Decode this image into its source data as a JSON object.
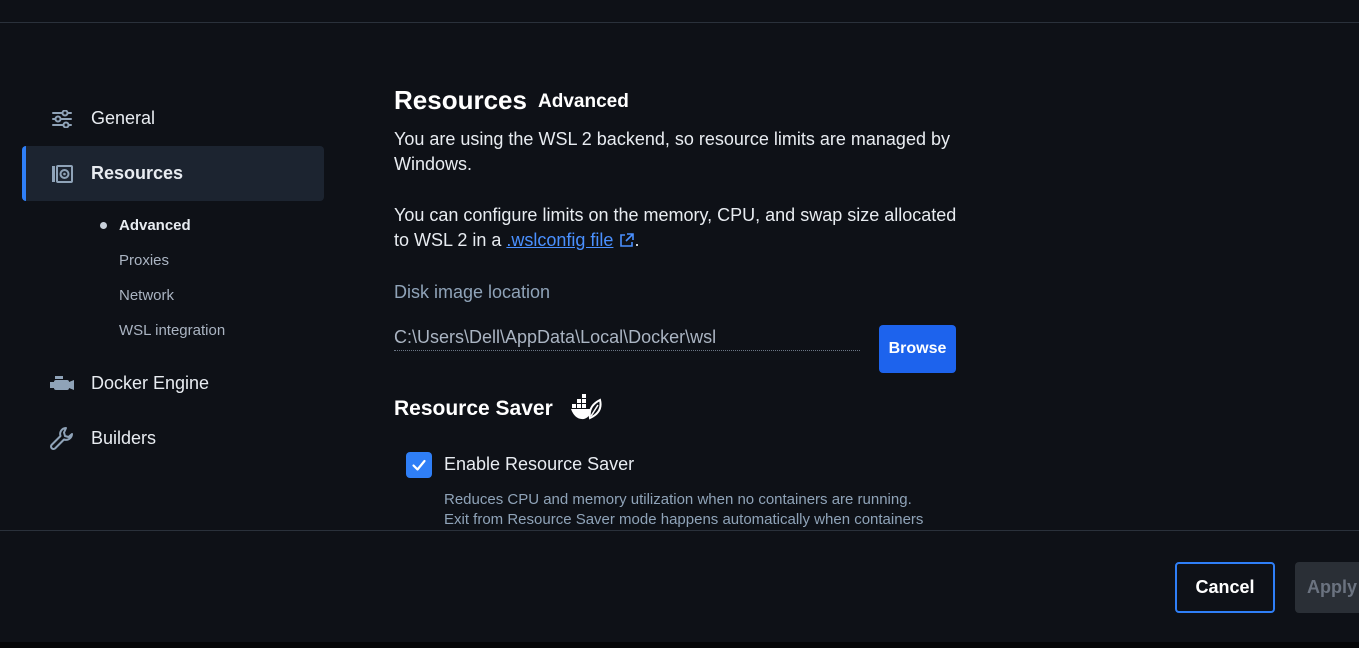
{
  "sidebar": {
    "items": [
      {
        "label": "General",
        "icon": "sliders-icon"
      },
      {
        "label": "Resources",
        "icon": "resources-icon"
      },
      {
        "label": "Docker Engine",
        "icon": "engine-icon"
      },
      {
        "label": "Builders",
        "icon": "wrench-icon"
      }
    ],
    "sub_items": [
      {
        "label": "Advanced"
      },
      {
        "label": "Proxies"
      },
      {
        "label": "Network"
      },
      {
        "label": "WSL integration"
      }
    ]
  },
  "main": {
    "title": "Resources",
    "subtitle": "Advanced",
    "para1": "You are using the WSL 2 backend, so resource limits are managed by Windows.",
    "para2_prefix": "You can configure limits on the memory, CPU, and swap size allocated to WSL 2 in a ",
    "para2_link": ".wslconfig file",
    "para2_suffix": ".",
    "disk_label": "Disk image location",
    "disk_value": "C:\\Users\\Dell\\AppData\\Local\\Docker\\wsl",
    "browse_label": "Browse",
    "saver_title": "Resource Saver",
    "enable_saver_label": "Enable Resource Saver",
    "enable_saver_checked": true,
    "saver_help_line1": "Reduces CPU and memory utilization when no containers are running.",
    "saver_help_line2": "Exit from Resource Saver mode happens automatically when containers"
  },
  "footer": {
    "cancel_label": "Cancel",
    "apply_label": "Apply"
  },
  "colors": {
    "accent": "#2f7ff7",
    "button": "#1d63ed",
    "link": "#4a90ff",
    "background": "#0e1117"
  }
}
